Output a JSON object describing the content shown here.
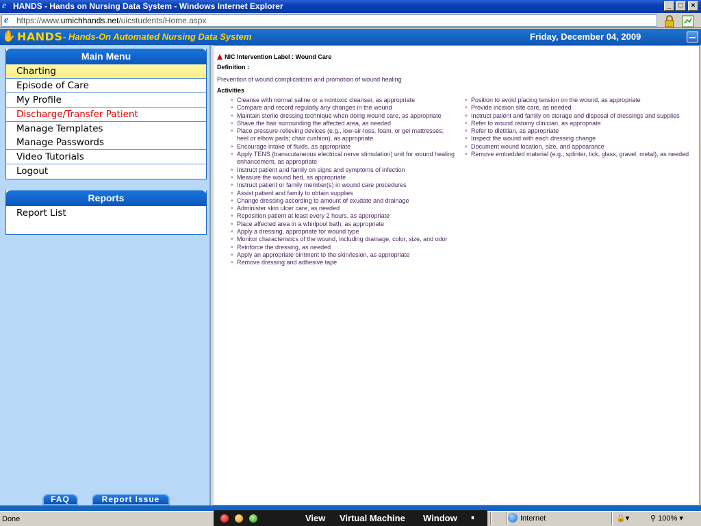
{
  "window": {
    "title": "HANDS - Hands on Nursing Data System - Windows Internet Explorer",
    "url_proto": "https://www.",
    "url_host": "umichhands.net",
    "url_path": "/uicstudents/Home.aspx"
  },
  "header": {
    "brand": "HANDS",
    "subtitle_dash": " - ",
    "subtitle": "Hands-On Automated Nursing Data System",
    "date": "Friday, December 04, 2009"
  },
  "main_menu": {
    "title": "Main Menu",
    "items": [
      {
        "label": "Charting"
      },
      {
        "label": "Episode of Care"
      },
      {
        "label": "My Profile"
      },
      {
        "label": "Discharge/Transfer Patient"
      },
      {
        "label": "Manage Templates"
      },
      {
        "label": "Manage Passwords"
      },
      {
        "label": "Video Tutorials"
      },
      {
        "label": "Logout"
      }
    ]
  },
  "reports": {
    "title": "Reports",
    "items": [
      {
        "label": "Report List"
      }
    ]
  },
  "footer_buttons": {
    "faq": "FAQ",
    "report_issue": "Report Issue"
  },
  "content": {
    "nic_label": "NIC Intervention Label : Wound Care",
    "definition_label": "Definition :",
    "definition_text": "Prevention of wound complications and promotion of wound healing",
    "activities_label": "Activities",
    "activities_col1": [
      "Cleanse with normal saline or a nontoxic cleanser, as appropriate",
      "Compare and record regularly any changes in the wound",
      "Maintain sterile dressing technique when doing wound care, as appropriate",
      "Shave the hair surrounding the affected area, as needed",
      "Place pressure-relieving devices (e.g., low-air-loss, foam, or gel mattresses; heel or elbow pads; chair cushion), as appropriate",
      "Encourage intake of fluids, as appropriate",
      "Apply TENS (transcutaneous electrical nerve stimulation) unit for wound healing enhancement, as appropriate",
      "Instruct patient and family on signs and symptoms of infection",
      "Measure the wound bed, as appropriate",
      "Instruct patient or family member(s) in wound care procedures",
      "Assist patient and family to obtain supplies",
      "Change dressing according to amount of exudate and drainage",
      "Administer skin ulcer care, as needed",
      "Reposition patient at least every 2 hours, as appropriate",
      "Place affected area in a whirlpool bath, as appropriate",
      "Apply a dressing, appropriate for wound type",
      "Monitor characteristics of the wound, including drainage, color, size, and odor",
      "Reinforce the dressing, as needed",
      "Apply an appropriate ointment to the skin/lesion, as appropriate",
      "Remove dressing and adhesive tape"
    ],
    "activities_col2": [
      "Position to avoid placing tension on the wound, as appropriate",
      "Provide incision site care, as needed",
      "Instruct patient and family on storage and disposal of dressings and supplies",
      "Refer to wound ostomy clinician, as appropriate",
      "Refer to dietitian, as appropriate",
      "Inspect the wound with each dressing change",
      "Document wound location, size, and appearance",
      "Remove embedded material (e.g., splinter, tick, glass, gravel, metal), as needed"
    ]
  },
  "statusbar": {
    "status": "Done",
    "zone": "Internet",
    "zoom": "100%"
  },
  "vm_menu": {
    "view": "View",
    "virtual_machine": "Virtual Machine",
    "window": "Window"
  }
}
